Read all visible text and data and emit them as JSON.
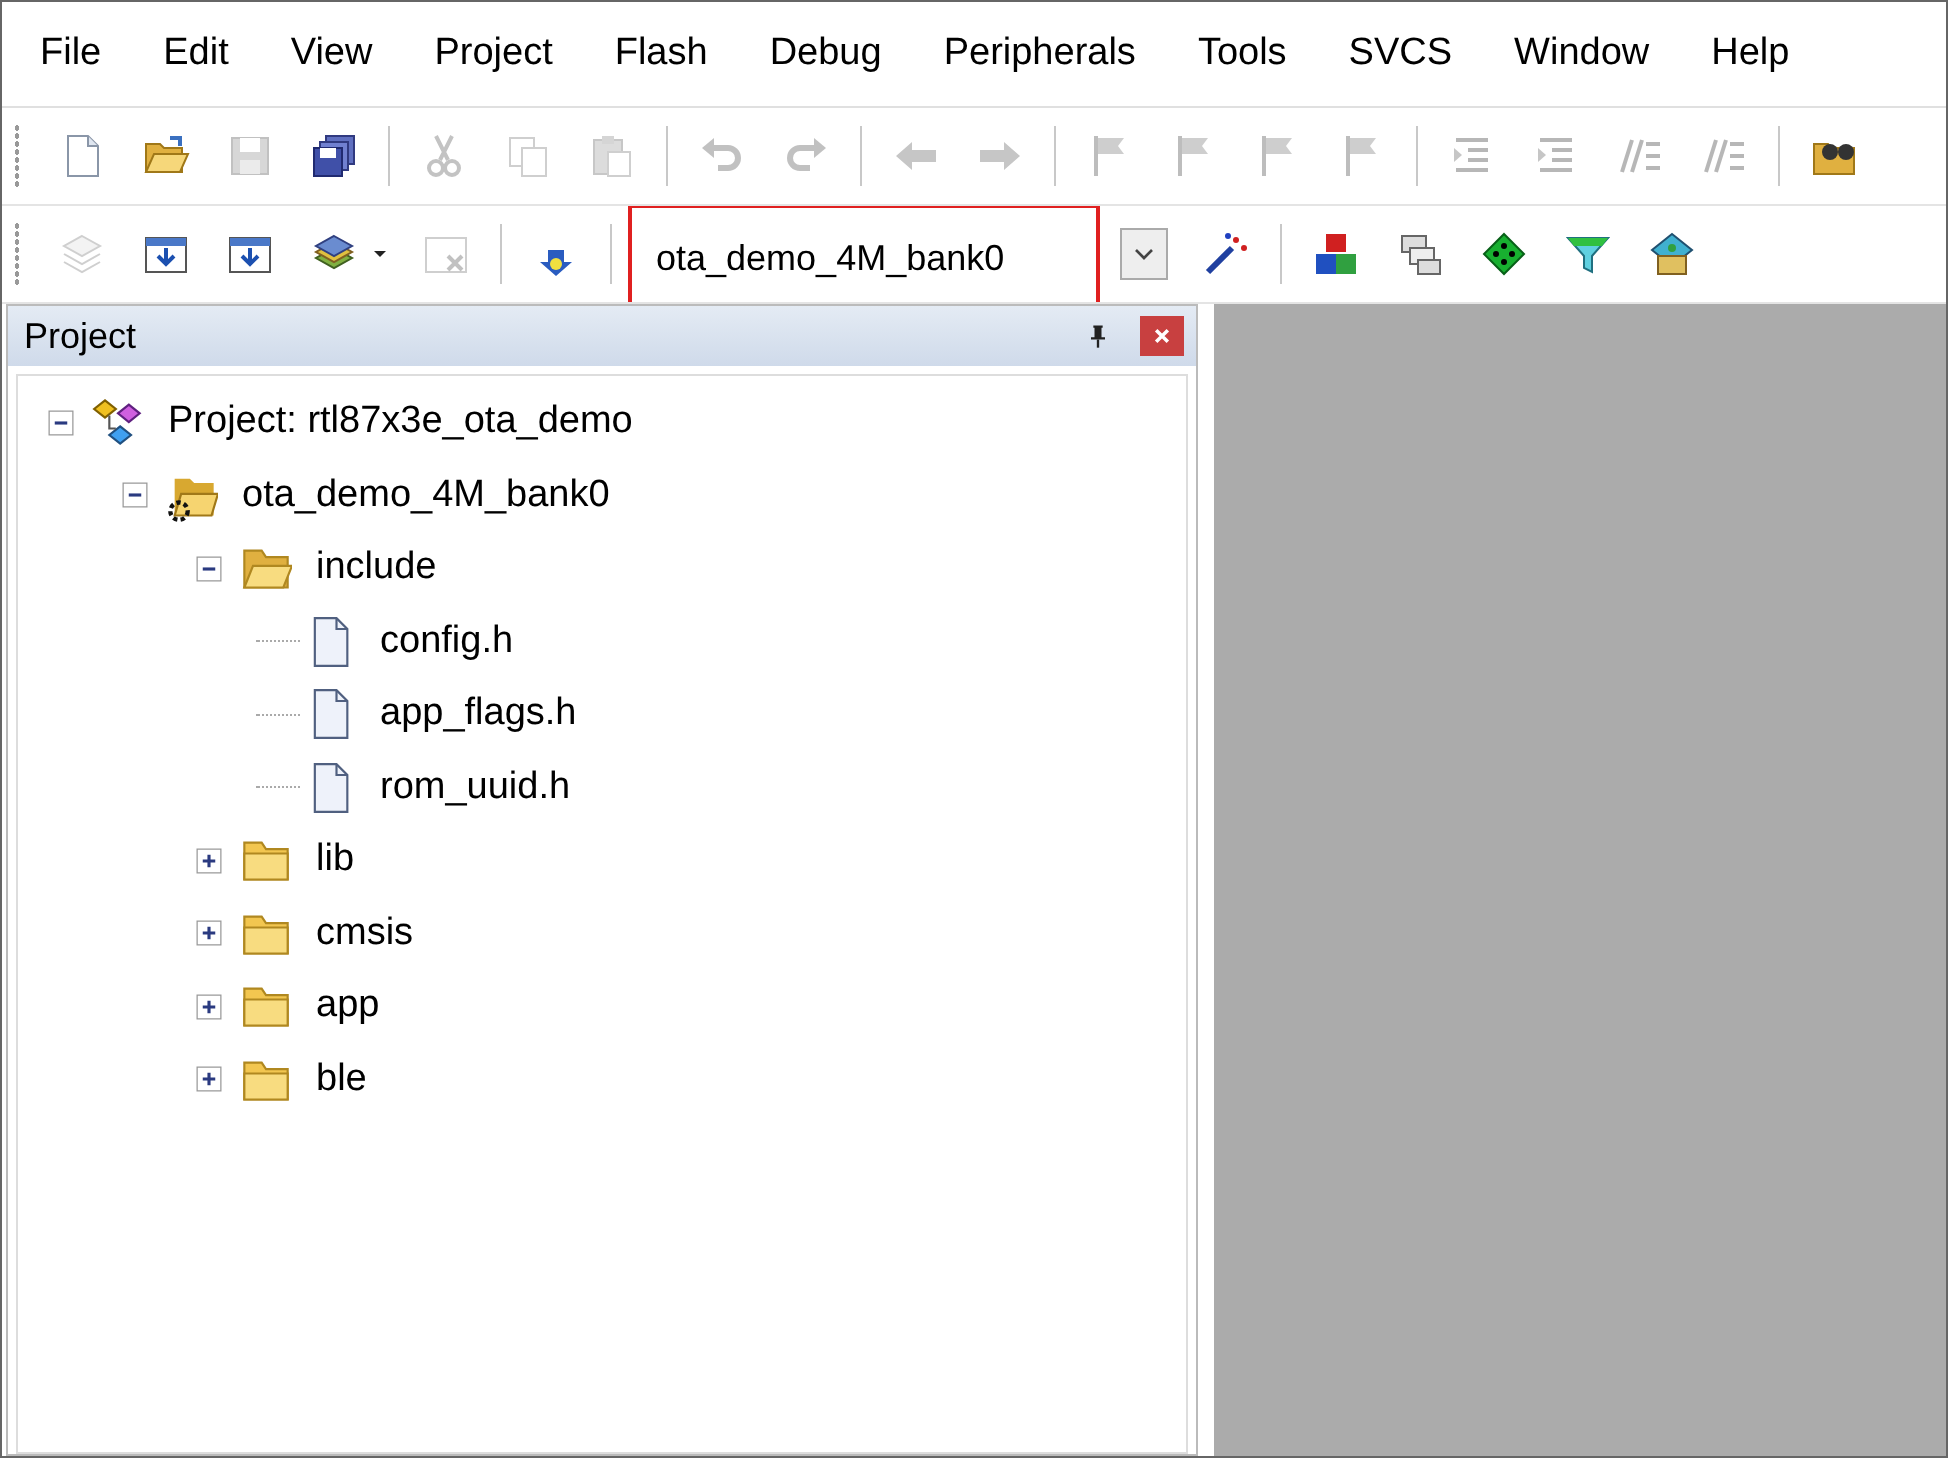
{
  "menu_bar": [
    {
      "label": "File"
    },
    {
      "label": "Edit"
    },
    {
      "label": "View"
    },
    {
      "label": "Project"
    },
    {
      "label": "Flash"
    },
    {
      "label": "Debug"
    },
    {
      "label": "Peripherals"
    },
    {
      "label": "Tools"
    },
    {
      "label": "SVCS"
    },
    {
      "label": "Window"
    },
    {
      "label": "Help"
    }
  ],
  "toolbar_1": [
    {
      "kind": "new",
      "disabled": false
    },
    {
      "kind": "open",
      "disabled": false
    },
    {
      "kind": "save",
      "disabled": true
    },
    {
      "kind": "saveall",
      "disabled": false
    },
    {
      "kind": "sep"
    },
    {
      "kind": "cut",
      "disabled": true
    },
    {
      "kind": "copy",
      "disabled": true
    },
    {
      "kind": "paste",
      "disabled": true
    },
    {
      "kind": "sep"
    },
    {
      "kind": "undo",
      "disabled": true
    },
    {
      "kind": "redo",
      "disabled": true
    },
    {
      "kind": "sep"
    },
    {
      "kind": "back",
      "disabled": true
    },
    {
      "kind": "forward",
      "disabled": true
    },
    {
      "kind": "sep"
    },
    {
      "kind": "flag",
      "disabled": true
    },
    {
      "kind": "flag",
      "disabled": true
    },
    {
      "kind": "flag",
      "disabled": true
    },
    {
      "kind": "flag",
      "disabled": true
    },
    {
      "kind": "sep"
    },
    {
      "kind": "indent",
      "disabled": true
    },
    {
      "kind": "indent",
      "disabled": true
    },
    {
      "kind": "comment",
      "disabled": true
    },
    {
      "kind": "comment",
      "disabled": true
    },
    {
      "kind": "sep"
    },
    {
      "kind": "findfiles",
      "disabled": false
    }
  ],
  "toolbar_2": [
    {
      "kind": "translate",
      "disabled": true
    },
    {
      "kind": "build",
      "disabled": false
    },
    {
      "kind": "build",
      "disabled": false
    },
    {
      "kind": "batch",
      "disabled": false
    },
    {
      "kind": "caret"
    },
    {
      "kind": "stop",
      "disabled": true
    },
    {
      "kind": "sep"
    },
    {
      "kind": "load",
      "disabled": false
    },
    {
      "kind": "sep"
    },
    {
      "kind": "target",
      "value": "ota_demo_4M_bank0"
    },
    {
      "kind": "wizard",
      "disabled": false
    },
    {
      "kind": "sep"
    },
    {
      "kind": "blocks",
      "disabled": false
    },
    {
      "kind": "windows",
      "disabled": false
    },
    {
      "kind": "diamond",
      "disabled": false
    },
    {
      "kind": "funnel",
      "disabled": false
    },
    {
      "kind": "multi",
      "disabled": false
    }
  ],
  "project_panel": {
    "title": "Project",
    "tree": [
      {
        "kind": "project",
        "label": "Project: rtl87x3e_ota_demo",
        "expanded": true,
        "children": [
          {
            "kind": "target",
            "label": "ota_demo_4M_bank0",
            "expanded": true,
            "children": [
              {
                "kind": "folder",
                "label": "include",
                "expanded": true,
                "children": [
                  {
                    "kind": "file",
                    "label": "config.h"
                  },
                  {
                    "kind": "file",
                    "label": "app_flags.h"
                  },
                  {
                    "kind": "file",
                    "label": "rom_uuid.h"
                  }
                ]
              },
              {
                "kind": "folder",
                "label": "lib",
                "expanded": false
              },
              {
                "kind": "folder",
                "label": "cmsis",
                "expanded": false
              },
              {
                "kind": "folder",
                "label": "app",
                "expanded": false
              },
              {
                "kind": "folder",
                "label": "ble",
                "expanded": false
              }
            ]
          }
        ]
      }
    ]
  }
}
